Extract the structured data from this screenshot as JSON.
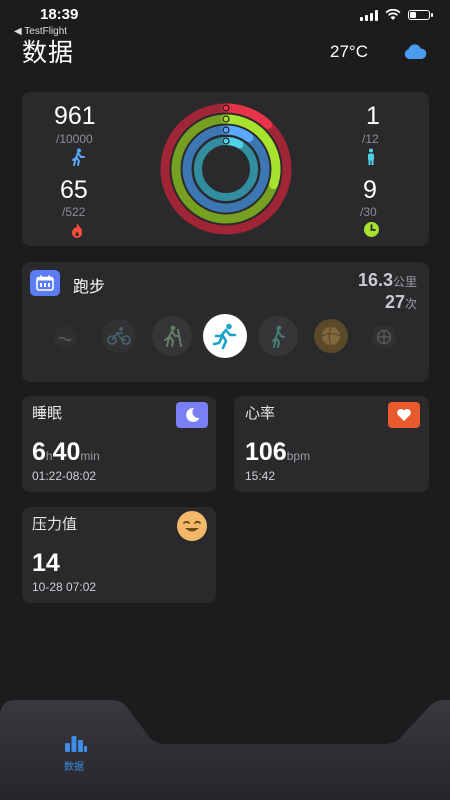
{
  "status_bar": {
    "time": "18:39",
    "back_app": "◀ TestFlight"
  },
  "header": {
    "title": "数据",
    "temperature": "27°C",
    "weather_icon": "cloud-icon"
  },
  "activity": {
    "steps": {
      "value": "961",
      "goal": "/10000",
      "icon": "walk-icon",
      "color": "#5aa9ff"
    },
    "calories": {
      "value": "65",
      "goal": "/522",
      "icon": "flame-icon",
      "color": "#ff4d3d"
    },
    "stand": {
      "value": "1",
      "goal": "/12",
      "icon": "stand-icon",
      "color": "#4fd1e8"
    },
    "exercise": {
      "value": "9",
      "goal": "/30",
      "icon": "clock-icon",
      "color": "#a6e22e"
    },
    "rings": [
      {
        "name": "calories",
        "color": "#e8334a",
        "progress": 0.12
      },
      {
        "name": "exercise",
        "color": "#a6e22e",
        "progress": 0.3
      },
      {
        "name": "steps",
        "color": "#5aa9ff",
        "progress": 0.1
      },
      {
        "name": "stand",
        "color": "#4fd1e8",
        "progress": 0.08
      }
    ]
  },
  "sport": {
    "title": "跑步",
    "distance": "16.3",
    "distance_unit": "公里",
    "count": "27",
    "count_unit": "次",
    "accent": "#5b7cf2",
    "activities": [
      "swim-icon",
      "cycling-icon",
      "hiking-icon",
      "running-icon",
      "walking-icon",
      "ball-icon",
      "basketball-icon"
    ],
    "selected": "running-icon"
  },
  "sleep": {
    "title": "睡眠",
    "hours": "6",
    "h_unit": "h",
    "minutes": "40",
    "min_unit": "min",
    "range": "01:22-08:02",
    "icon": "moon-icon",
    "color": "#7b7ff5"
  },
  "heart": {
    "title": "心率",
    "value": "106",
    "unit": "bpm",
    "time": "15:42",
    "icon": "heart-icon",
    "color": "#e85a2c"
  },
  "stress": {
    "title": "压力值",
    "value": "14",
    "time": "10-28 07:02",
    "icon": "smile-icon",
    "color": "#f2b96a"
  },
  "tabbar": {
    "label": "数据",
    "icon": "bar-chart-icon",
    "color": "#3f8be8"
  }
}
